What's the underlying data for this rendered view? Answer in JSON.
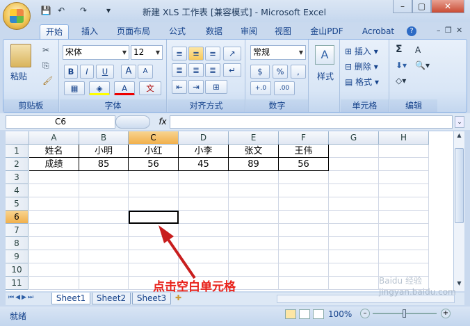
{
  "window": {
    "title": "新建 XLS 工作表  [兼容模式] - Microsoft Excel",
    "controls": {
      "minimize": "–",
      "maximize": "▢",
      "close": "✕"
    },
    "app_controls": {
      "minimize": "–",
      "restore": "❐",
      "close": "✕"
    }
  },
  "qat": {
    "save": "💾",
    "undo": "↶",
    "redo": "↷",
    "customize": "▾"
  },
  "tabs": [
    "开始",
    "插入",
    "页面布局",
    "公式",
    "数据",
    "审阅",
    "视图",
    "金山PDF",
    "Acrobat"
  ],
  "active_tab": "开始",
  "help": "?",
  "ribbon": {
    "clipboard": {
      "label": "剪贴板",
      "paste": "粘贴"
    },
    "font": {
      "label": "字体",
      "name": "宋体",
      "size": "12",
      "bold": "B",
      "italic": "I",
      "underline": "U",
      "grow": "A",
      "shrink": "A",
      "font_color": "A",
      "phonetic": "文"
    },
    "alignment": {
      "label": "对齐方式"
    },
    "number": {
      "label": "数字",
      "format": "常规",
      "percent": "%",
      "comma": ",",
      "inc_decimal": "+.0",
      "dec_decimal": ".00"
    },
    "styles": {
      "label": "样式"
    },
    "cells": {
      "label": "单元格",
      "insert": "插入",
      "delete": "删除",
      "format": "格式"
    },
    "editing": {
      "label": "编辑",
      "sum": "Σ",
      "sort": "A"
    }
  },
  "formula_bar": {
    "name_box": "C6",
    "fx": "fx",
    "value": ""
  },
  "sheet": {
    "columns": [
      "A",
      "B",
      "C",
      "D",
      "E",
      "F",
      "G",
      "H"
    ],
    "selected_column": "C",
    "rows": [
      "1",
      "2",
      "3",
      "4",
      "5",
      "6",
      "7",
      "8",
      "9",
      "10",
      "11"
    ],
    "selected_row": "6",
    "data": [
      [
        "姓名",
        "小明",
        "小红",
        "小李",
        "张文",
        "王伟"
      ],
      [
        "成绩",
        "85",
        "56",
        "45",
        "89",
        "56"
      ]
    ],
    "active_cell": "C6"
  },
  "sheet_tabs": [
    "Sheet1",
    "Sheet2",
    "Sheet3"
  ],
  "status": {
    "ready": "就绪",
    "zoom": "100%"
  },
  "annotation": "点击空白单元格",
  "watermark": "Baidu 经验\njingyan.baidu.com",
  "colors": {
    "arrow": "#c81e1e",
    "annotation": "#e8211a",
    "selection_header": "#f1b04c"
  }
}
